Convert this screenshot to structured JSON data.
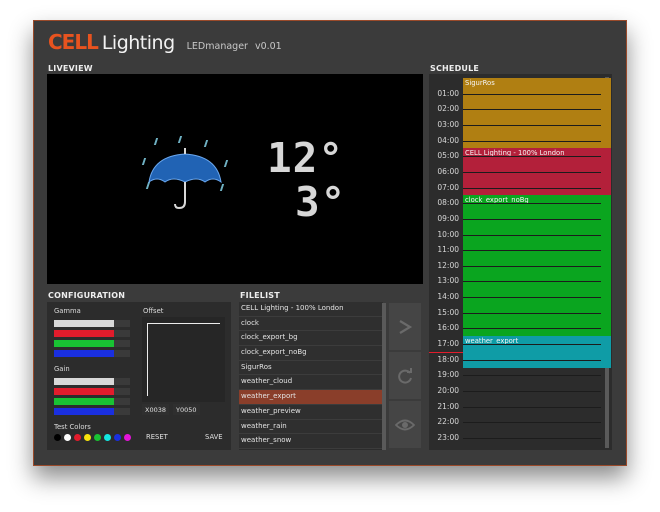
{
  "app": {
    "brand_cell": "CELL",
    "brand_light": "Lighting",
    "app_name": "LEDmanager",
    "version": "v0.01"
  },
  "colors": {
    "accent": "#e8531f",
    "window_bg": "#3b3b3b",
    "panel_bg": "#2c2c2c",
    "selection": "#8a3e2a",
    "gamma_white": "#d8d8d8",
    "red": "#e21c2c",
    "green": "#19c233",
    "blue": "#1a2fe0"
  },
  "liveview": {
    "label": "LIVEVIEW",
    "weather_icon": "rain-umbrella-icon",
    "temp_high": "12°",
    "temp_low": "3°"
  },
  "configuration": {
    "label": "CONFIGURATION",
    "gamma_label": "Gamma",
    "gain_label": "Gain",
    "offset_label": "Offset",
    "offset_x": "X0038",
    "offset_y": "Y0050",
    "test_colors_label": "Test  Colors",
    "reset_label": "RESET",
    "save_label": "SAVE",
    "gamma_levels": [
      1.0,
      1.0,
      1.0,
      1.0
    ],
    "gain_levels": [
      1.0,
      1.0,
      1.0,
      1.0
    ],
    "test_colors": [
      "#000000",
      "#ffffff",
      "#e21c2c",
      "#f5e20d",
      "#19c233",
      "#13e6e0",
      "#1a2fe0",
      "#e414d9"
    ]
  },
  "filelist": {
    "label": "FILELIST",
    "items": [
      "CELL  Lighting  -  100%  London",
      "clock",
      "clock_export_bg",
      "clock_export_noBg",
      "SigurRos",
      "weather_cloud",
      "weather_export",
      "weather_preview",
      "weather_rain",
      "weather_snow"
    ],
    "selected_index": 6,
    "buttons": [
      "play-icon",
      "refresh-icon",
      "eye-icon"
    ]
  },
  "schedule": {
    "label": "SCHEDULE",
    "hours": [
      "01:00",
      "02:00",
      "03:00",
      "04:00",
      "05:00",
      "06:00",
      "07:00",
      "08:00",
      "09:00",
      "10:00",
      "11:00",
      "12:00",
      "13:00",
      "14:00",
      "15:00",
      "16:00",
      "17:00",
      "18:00",
      "19:00",
      "20:00",
      "21:00",
      "22:00",
      "23:00"
    ],
    "current_time_marker": "17:30",
    "blocks": [
      {
        "label": "SigurRos",
        "start": "00:00",
        "end": "04:30",
        "color": "#b07f12"
      },
      {
        "label": "CELL  Lighting  -  100%  London",
        "start": "04:30",
        "end": "07:30",
        "color": "#b3203a"
      },
      {
        "label": "clock_export_noBg",
        "start": "07:30",
        "end": "16:30",
        "color": "#0aa51f"
      },
      {
        "label": "weather_export",
        "start": "16:30",
        "end": "18:30",
        "color": "#0f9ca6"
      }
    ]
  }
}
